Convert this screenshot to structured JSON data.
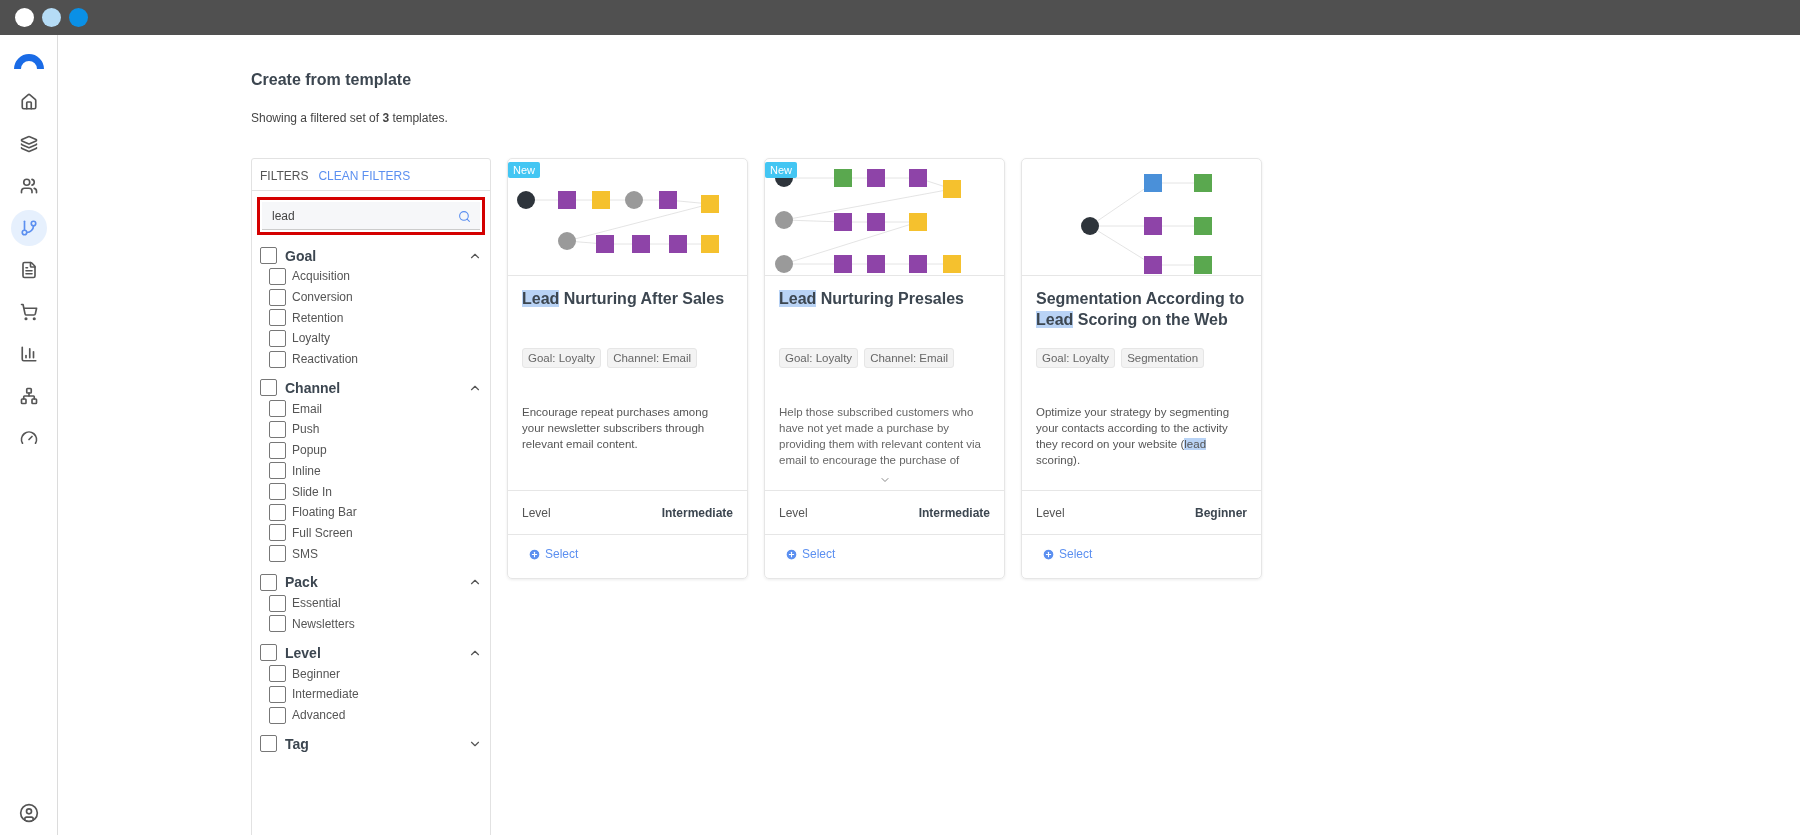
{
  "sidebar": {
    "items": [
      {
        "selected": false
      },
      {
        "selected": false
      },
      {
        "selected": false
      },
      {
        "selected": true
      },
      {
        "selected": false
      },
      {
        "selected": false
      },
      {
        "selected": false
      },
      {
        "selected": false
      },
      {
        "selected": false
      }
    ]
  },
  "header": {
    "title": "Create from template",
    "summary": "Showing a filtered set of **3** templates."
  },
  "filters": {
    "label": "FILTERS",
    "clear": "CLEAN FILTERS",
    "search": {
      "value": "lead"
    },
    "groups": [
      {
        "label": "Goal",
        "checked": false,
        "expanded": true,
        "options": [
          {
            "label": "Acquisition",
            "checked": false
          },
          {
            "label": "Conversion",
            "checked": false
          },
          {
            "label": "Retention",
            "checked": false
          },
          {
            "label": "Loyalty",
            "checked": false
          },
          {
            "label": "Reactivation",
            "checked": false
          }
        ]
      },
      {
        "label": "Channel",
        "checked": false,
        "expanded": true,
        "options": [
          {
            "label": "Email",
            "checked": false
          },
          {
            "label": "Push",
            "checked": false
          },
          {
            "label": "Popup",
            "checked": false
          },
          {
            "label": "Inline",
            "checked": false
          },
          {
            "label": "Slide In",
            "checked": false
          },
          {
            "label": "Floating Bar",
            "checked": false
          },
          {
            "label": "Full Screen",
            "checked": false
          },
          {
            "label": "SMS",
            "checked": false
          }
        ]
      },
      {
        "label": "Pack",
        "checked": false,
        "expanded": true,
        "options": [
          {
            "label": "Essential",
            "checked": false
          },
          {
            "label": "Newsletters",
            "checked": false
          }
        ]
      },
      {
        "label": "Level",
        "checked": false,
        "expanded": true,
        "options": [
          {
            "label": "Beginner",
            "checked": false
          },
          {
            "label": "Intermediate",
            "checked": false
          },
          {
            "label": "Advanced",
            "checked": false
          }
        ]
      },
      {
        "label": "Tag",
        "checked": false,
        "expanded": false
      }
    ]
  },
  "templates": [
    {
      "badge": "New",
      "title": "**Lead** Nurturing After Sales",
      "tags": [
        "Goal: Loyalty",
        "Channel: Email"
      ],
      "description": "Encourage repeat purchases among your newsletter subscribers through relevant email content.",
      "truncated": false,
      "level_label": "Level",
      "level": "Intermediate",
      "action": "Select"
    },
    {
      "badge": "New",
      "title": "**Lead** Nurturing Presales",
      "tags": [
        "Goal: Loyalty",
        "Channel: Email"
      ],
      "description": "Help those subscribed customers who have not yet made a purchase by providing them with relevant content via email to encourage the purchase of",
      "truncated": true,
      "level_label": "Level",
      "level": "Intermediate",
      "action": "Select"
    },
    {
      "title": "Segmentation According to **Lead** Scoring on the Web",
      "tags": [
        "Goal: Loyalty",
        "Segmentation"
      ],
      "description": "Optimize your strategy by segmenting your contacts according to the activity they record on your website (**lead** scoring).",
      "truncated": false,
      "level_label": "Level",
      "level": "Beginner",
      "action": "Select"
    }
  ]
}
